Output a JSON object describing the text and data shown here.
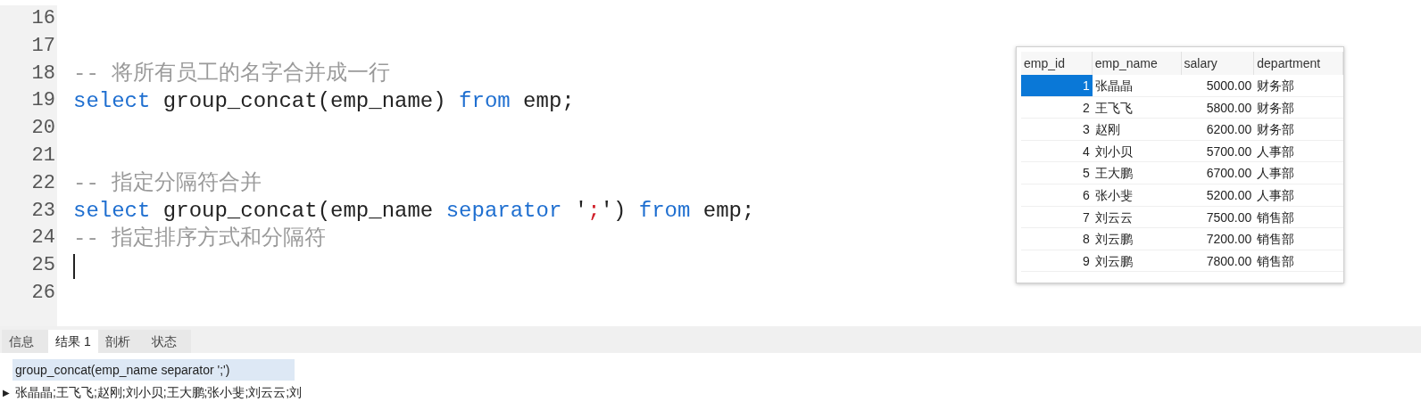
{
  "editor": {
    "lines": [
      {
        "number": "16"
      },
      {
        "number": "17"
      },
      {
        "number": "18",
        "tokens": [
          {
            "kind": "comment",
            "text": "-- 将所有员工的名字合并成一行"
          }
        ]
      },
      {
        "number": "19",
        "tokens": [
          {
            "kind": "keyword",
            "text": "select"
          },
          {
            "kind": "plain",
            "text": " group_concat(emp_name) "
          },
          {
            "kind": "keyword",
            "text": "from"
          },
          {
            "kind": "plain",
            "text": " emp;"
          }
        ]
      },
      {
        "number": "20"
      },
      {
        "number": "21"
      },
      {
        "number": "22",
        "tokens": [
          {
            "kind": "comment",
            "text": "-- 指定分隔符合并"
          }
        ]
      },
      {
        "number": "23",
        "tokens": [
          {
            "kind": "keyword",
            "text": "select"
          },
          {
            "kind": "plain",
            "text": " group_concat(emp_name "
          },
          {
            "kind": "keyword",
            "text": "separator"
          },
          {
            "kind": "plain",
            "text": " '"
          },
          {
            "kind": "string",
            "text": ";"
          },
          {
            "kind": "plain",
            "text": "') "
          },
          {
            "kind": "keyword",
            "text": "from"
          },
          {
            "kind": "plain",
            "text": " emp;"
          }
        ]
      },
      {
        "number": "24",
        "tokens": [
          {
            "kind": "comment",
            "text": "-- 指定排序方式和分隔符"
          }
        ]
      },
      {
        "number": "25",
        "cursor": true
      },
      {
        "number": "26"
      }
    ]
  },
  "emp_table": {
    "columns": [
      "emp_id",
      "emp_name",
      "salary",
      "department"
    ],
    "rows": [
      {
        "cells": [
          "1",
          "张晶晶",
          "5000.00",
          "财务部"
        ],
        "selected": true
      },
      {
        "cells": [
          "2",
          "王飞飞",
          "5800.00",
          "财务部"
        ],
        "selected": false
      },
      {
        "cells": [
          "3",
          "赵刚",
          "6200.00",
          "财务部"
        ],
        "selected": false
      },
      {
        "cells": [
          "4",
          "刘小贝",
          "5700.00",
          "人事部"
        ],
        "selected": false
      },
      {
        "cells": [
          "5",
          "王大鹏",
          "6700.00",
          "人事部"
        ],
        "selected": false
      },
      {
        "cells": [
          "6",
          "张小斐",
          "5200.00",
          "人事部"
        ],
        "selected": false
      },
      {
        "cells": [
          "7",
          "刘云云",
          "7500.00",
          "销售部"
        ],
        "selected": false
      },
      {
        "cells": [
          "8",
          "刘云鹏",
          "7200.00",
          "销售部"
        ],
        "selected": false
      },
      {
        "cells": [
          "9",
          "刘云鹏",
          "7800.00",
          "销售部"
        ],
        "selected": false
      }
    ]
  },
  "result_tabs": [
    {
      "label": "信息",
      "selected": false
    },
    {
      "label": "结果 1",
      "selected": true
    },
    {
      "label": "剖析",
      "selected": false
    },
    {
      "label": "状态",
      "selected": false
    }
  ],
  "result_grid": {
    "column": "group_concat(emp_name separator ';')",
    "row_marker": "▶",
    "value": "张晶晶;王飞飞;赵刚;刘小贝;王大鹏;张小斐;刘云云;刘"
  }
}
